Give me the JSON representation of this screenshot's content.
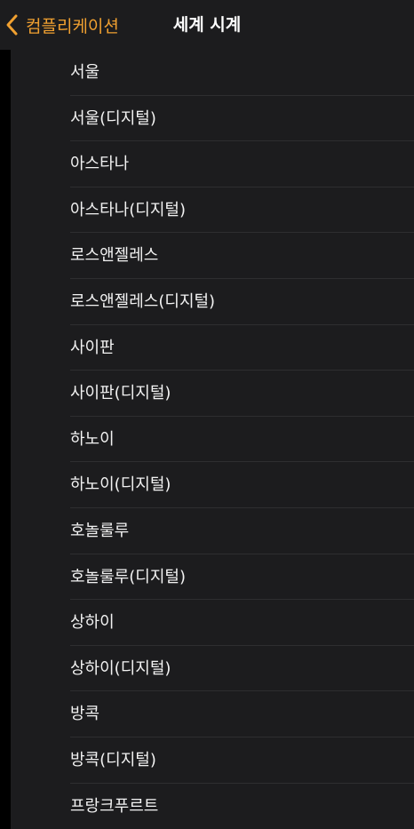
{
  "nav": {
    "back_label": "컴플리케이션",
    "title": "세계 시계",
    "accent_color": "#f0a030",
    "back_icon": "chevron-left-icon"
  },
  "cities": [
    "서울",
    "서울(디지털)",
    "아스타나",
    "아스타나(디지털)",
    "로스앤젤레스",
    "로스앤젤레스(디지털)",
    "사이판",
    "사이판(디지털)",
    "하노이",
    "하노이(디지털)",
    "호놀룰루",
    "호놀룰루(디지털)",
    "상하이",
    "상하이(디지털)",
    "방콕",
    "방콕(디지털)",
    "프랑크푸르트"
  ]
}
